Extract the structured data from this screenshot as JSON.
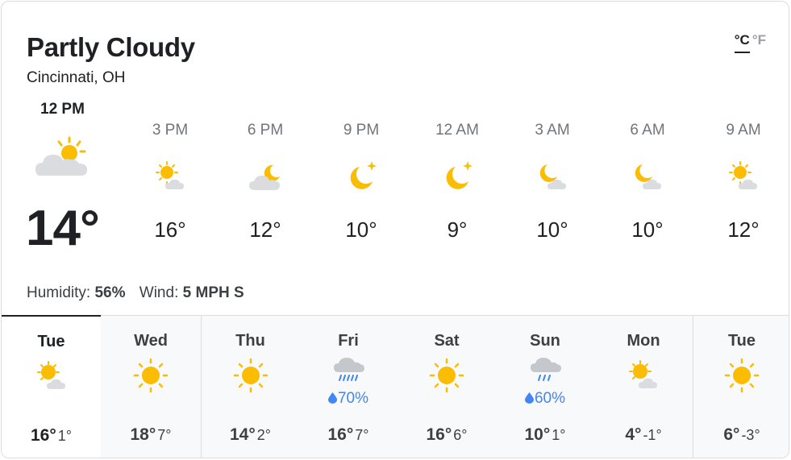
{
  "header": {
    "condition": "Partly Cloudy",
    "location": "Cincinnati, OH",
    "unit_celsius": "°C",
    "unit_fahrenheit": "°F"
  },
  "current": {
    "time": "12 PM",
    "icon": "partly-cloudy-day-icon",
    "temp": "14°"
  },
  "hourly": [
    {
      "time": "3 PM",
      "icon": "sun-behind-cloud-icon",
      "temp": "16°"
    },
    {
      "time": "6 PM",
      "icon": "moon-behind-cloud-icon",
      "temp": "12°"
    },
    {
      "time": "9 PM",
      "icon": "clear-night-icon",
      "temp": "10°"
    },
    {
      "time": "12 AM",
      "icon": "clear-night-icon",
      "temp": "9°"
    },
    {
      "time": "3 AM",
      "icon": "moon-small-cloud-icon",
      "temp": "10°"
    },
    {
      "time": "6 AM",
      "icon": "moon-small-cloud-icon",
      "temp": "10°"
    },
    {
      "time": "9 AM",
      "icon": "sun-behind-cloud-icon",
      "temp": "12°"
    }
  ],
  "details": {
    "humidity_label": "Humidity:",
    "humidity_value": "56%",
    "wind_label": "Wind:",
    "wind_value": "5 MPH S"
  },
  "daily": [
    {
      "day": "Tue",
      "icon": "sun-behind-cloud-icon",
      "precip": "",
      "hi": "16°",
      "lo": "1°",
      "selected": true
    },
    {
      "day": "Wed",
      "icon": "sunny-icon",
      "precip": "",
      "hi": "18°",
      "lo": "7°",
      "selected": false
    },
    {
      "day": "Thu",
      "icon": "sunny-icon",
      "precip": "",
      "hi": "14°",
      "lo": "2°",
      "selected": false
    },
    {
      "day": "Fri",
      "icon": "rain-cloud-icon",
      "precip": "70%",
      "hi": "16°",
      "lo": "7°",
      "selected": false
    },
    {
      "day": "Sat",
      "icon": "sunny-icon",
      "precip": "",
      "hi": "16°",
      "lo": "6°",
      "selected": false
    },
    {
      "day": "Sun",
      "icon": "rain-cloud-icon",
      "precip": "60%",
      "hi": "10°",
      "lo": "1°",
      "selected": false
    },
    {
      "day": "Mon",
      "icon": "sun-behind-cloud-icon",
      "precip": "",
      "hi": "4°",
      "lo": "-1°",
      "selected": false
    },
    {
      "day": "Tue",
      "icon": "sunny-icon",
      "precip": "",
      "hi": "6°",
      "lo": "-3°",
      "selected": false
    }
  ],
  "colors": {
    "sun": "#fbbc04",
    "cloud": "#dadce0",
    "rain": "#4285f4",
    "text": "#202124"
  }
}
